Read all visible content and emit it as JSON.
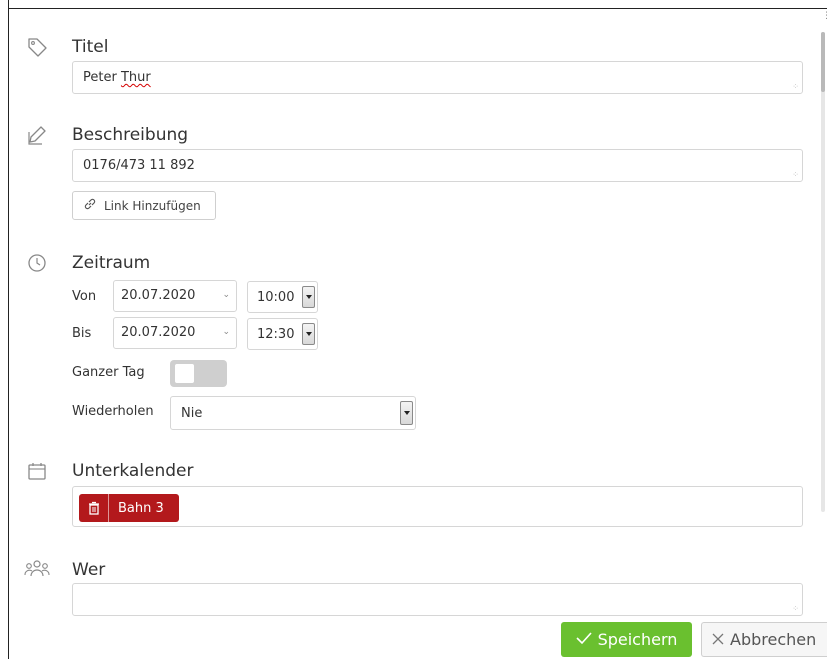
{
  "title_section": {
    "label": "Titel",
    "value_first": "Peter ",
    "value_misspelled": "Thur"
  },
  "description_section": {
    "label": "Beschreibung",
    "value": "0176/473 11 892",
    "link_button": "Link Hinzufügen"
  },
  "period_section": {
    "label": "Zeitraum",
    "from_label": "Von",
    "from_date": "20.07.2020",
    "from_time": "10:00",
    "to_label": "Bis",
    "to_date": "20.07.2020",
    "to_time": "12:30",
    "all_day_label": "Ganzer Tag",
    "all_day_on": false,
    "repeat_label": "Wiederholen",
    "repeat_value": "Nie"
  },
  "subcalendar_section": {
    "label": "Unterkalender",
    "tags": [
      {
        "label": "Bahn 3",
        "color": "#b3191c"
      }
    ]
  },
  "who_section": {
    "label": "Wer",
    "value": ""
  },
  "footer": {
    "save_label": "Speichern",
    "cancel_label": "Abbrechen",
    "save_color": "#6ac02f"
  },
  "icons": {
    "title": "tag-icon",
    "description": "edit-icon",
    "period": "clock-icon",
    "subcalendar": "calendar-icon",
    "who": "people-icon",
    "link": "link-icon",
    "delete": "trash-icon",
    "save": "check-icon",
    "cancel": "close-icon"
  }
}
